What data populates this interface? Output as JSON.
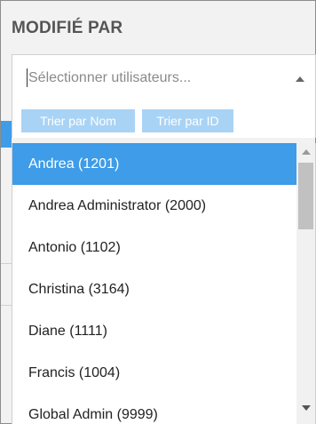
{
  "section": {
    "title": "MODIFIÉ PAR"
  },
  "select": {
    "placeholder": "Sélectionner utilisateurs..."
  },
  "sort": {
    "by_name": "Trier par Nom",
    "by_id": "Trier par ID"
  },
  "users": [
    {
      "label": "Andrea (1201)",
      "selected": true
    },
    {
      "label": "Andrea Administrator (2000)",
      "selected": false
    },
    {
      "label": "Antonio (1102)",
      "selected": false
    },
    {
      "label": "Christina (3164)",
      "selected": false
    },
    {
      "label": "Diane (1111)",
      "selected": false
    },
    {
      "label": "Francis (1004)",
      "selected": false
    },
    {
      "label": "Global Admin (9999)",
      "selected": false
    }
  ],
  "colors": {
    "selected": "#3e9ce8",
    "sort_button": "#a9d3f5",
    "title": "#555555"
  }
}
